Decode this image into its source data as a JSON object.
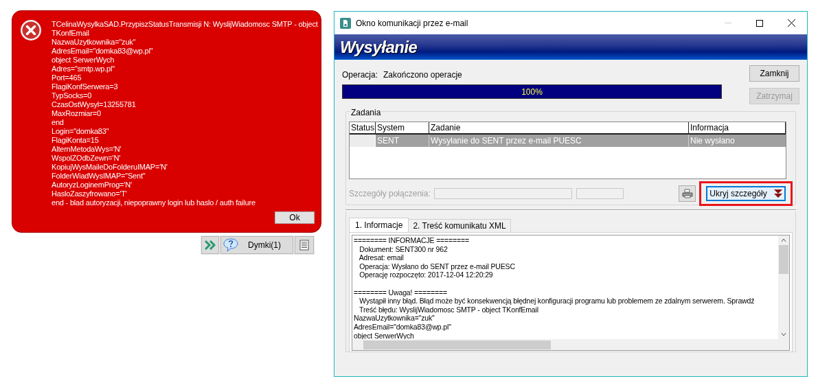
{
  "error_dialog": {
    "lines": [
      "TCelinaWysylkaSAD.PrzypiszStatusTransmisji N: WyslijWiadomosc SMTP - object",
      "TKonfEmail",
      "NazwaUzytkownika=\"zuk\"",
      "AdresEmail=\"domka83@wp.pl\"",
      "object SerwerWych",
      "Adres=\"smtp.wp.pl\"",
      "Port=465",
      "FlagiKonfSerwera=3",
      "TypSocks=0",
      "CzasOstWysyl=13255781",
      "MaxRozmiar=0",
      "end",
      "Login=\"domka83\"",
      "FlagiKonta=15",
      "AlternMetodaWys='N'",
      "WspolZOdbZewn='N'",
      "KopiujWysMaileDoFolderuIMAP='N'",
      "FolderWiadWysIMAP=\"Sent\"",
      "AutoryzLoginemProg='N'",
      "HasloZaszyfrowano='T'",
      "end - blad autoryzacji, niepoprawny login lub haslo / auth failure"
    ],
    "ok_button": "Ok"
  },
  "hint_toolbar": {
    "hint_button": "Dymki(1)"
  },
  "window": {
    "title": "Okno komunikacji przez e-mail",
    "banner": "Wysyłanie",
    "operation_label": "Operacja:",
    "operation_value": "Zakończono operacje",
    "progress": {
      "level": 1,
      "reading": "100%"
    },
    "buttons": [
      {
        "label": "Zamknij",
        "disabled": false
      },
      {
        "label": "Zatrzymaj",
        "disabled": true
      }
    ],
    "tasks": {
      "title": "Zadania",
      "columns": [
        "Status",
        "System",
        "Zadanie",
        "Informacja"
      ],
      "rows": [
        {
          "system": "SENT",
          "task": "Wysyłanie do SENT przez e-mail PUESC",
          "info": "Nie wysłano",
          "selected": true
        }
      ]
    },
    "connection": {
      "label": "Szczegóły połączenia:",
      "disabled": true
    },
    "details_button": {
      "label": "Ukryj szczegóły",
      "highlighted": true
    },
    "tabs": [
      {
        "label": "1. Informacje",
        "selected": true
      },
      {
        "label": "2. Treść komunikatu XML",
        "selected": false
      }
    ],
    "log_sections": [
      {
        "lines": [
          "======== INFORMACJE ========",
          "   Dokument: SENT300 nr 962",
          "   Adresat: email",
          "   Operacja: Wysłano do SENT przez e-mail PUESC",
          "   Operację rozpoczęto: 2017-12-04 12:20:29"
        ]
      },
      {
        "lines": [
          "======== Uwaga! ========",
          "   Wystąpił inny błąd. Błąd może być konsekwencją błędnej konfiguracji programu lub problemem ze zdalnym serwerem. Sprawdź",
          "   Treść błędu: WyslijWiadomosc SMTP - object TKonfEmail",
          "NazwaUzytkownika=\"zuk\"",
          "AdresEmail=\"domka83@wp.pl\"",
          "object SerwerWych"
        ]
      }
    ]
  }
}
